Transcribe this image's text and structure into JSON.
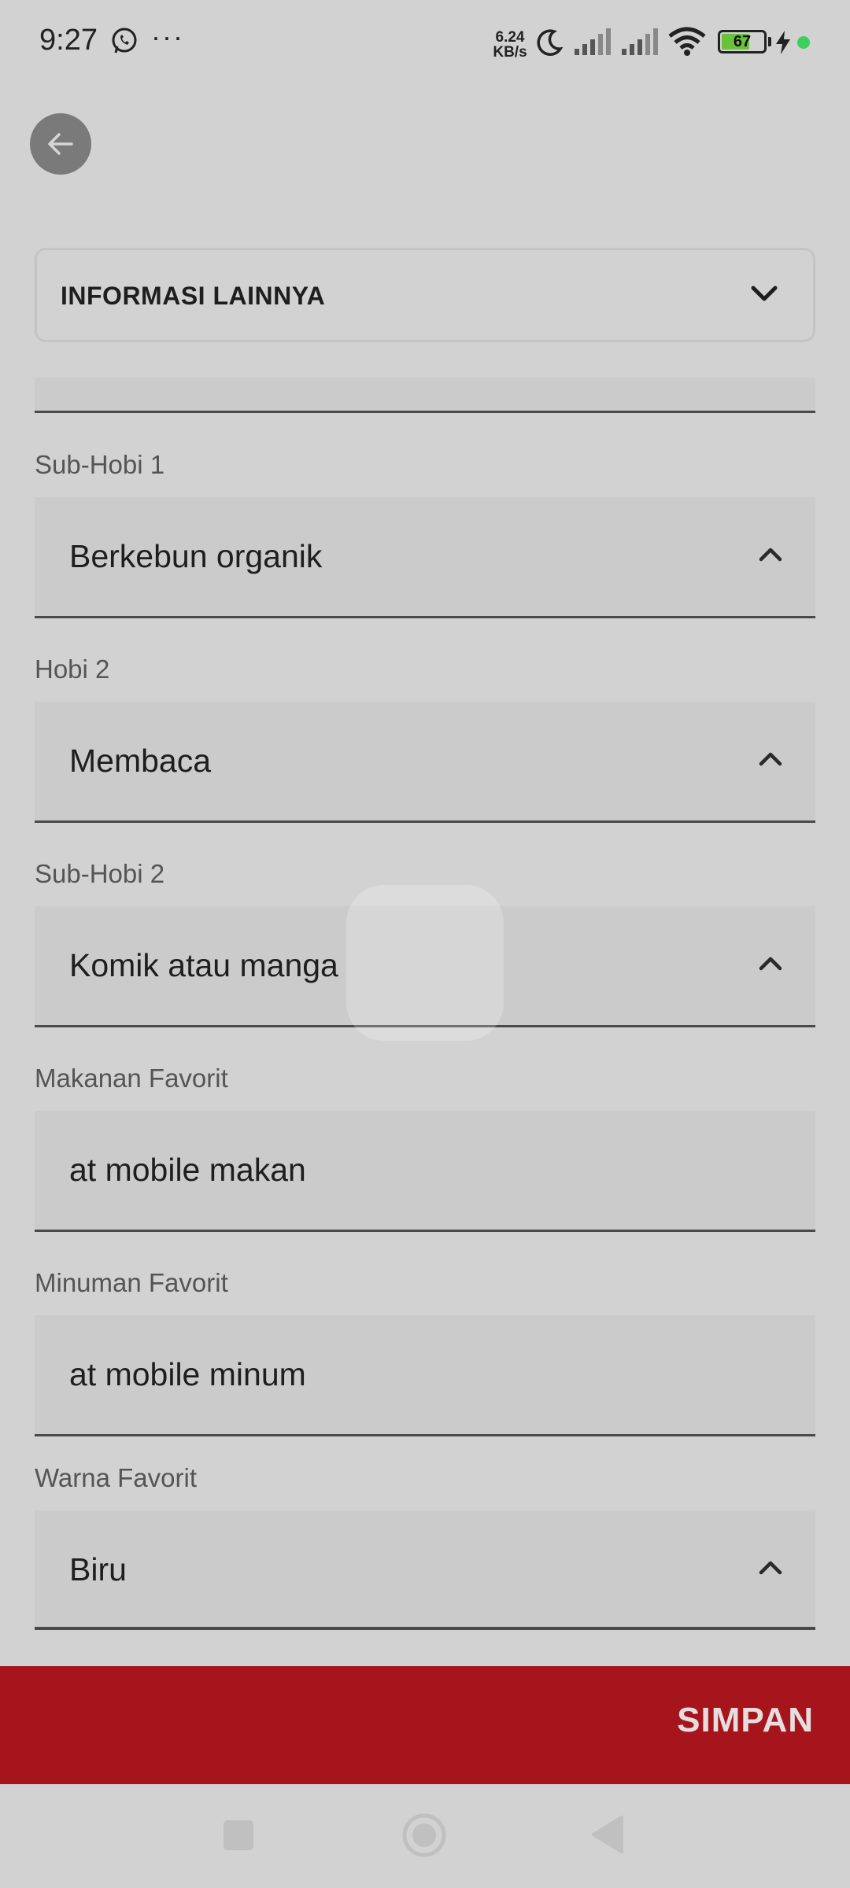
{
  "status_bar": {
    "time": "9:27",
    "dots": "···",
    "speed_value": "6.24",
    "speed_unit": "KB/s",
    "battery": "67",
    "battery_level": 0.67
  },
  "section": {
    "title": "INFORMASI LAINNYA"
  },
  "fields": [
    {
      "label": "Sub-Hobi 1",
      "value": "Berkebun organik"
    },
    {
      "label": "Hobi 2",
      "value": "Membaca"
    },
    {
      "label": "Sub-Hobi 2",
      "value": "Komik atau manga"
    },
    {
      "label": "Makanan Favorit",
      "value": "at mobile makan"
    },
    {
      "label": "Minuman Favorit",
      "value": "at mobile minum"
    },
    {
      "label": "Warna Favorit",
      "value": "Biru"
    }
  ],
  "actions": {
    "save_label": "SIMPAN"
  },
  "colors": {
    "background": "#d2d2d2",
    "save_bar": "#a6141c",
    "field_bg": "#cbcbcb"
  }
}
